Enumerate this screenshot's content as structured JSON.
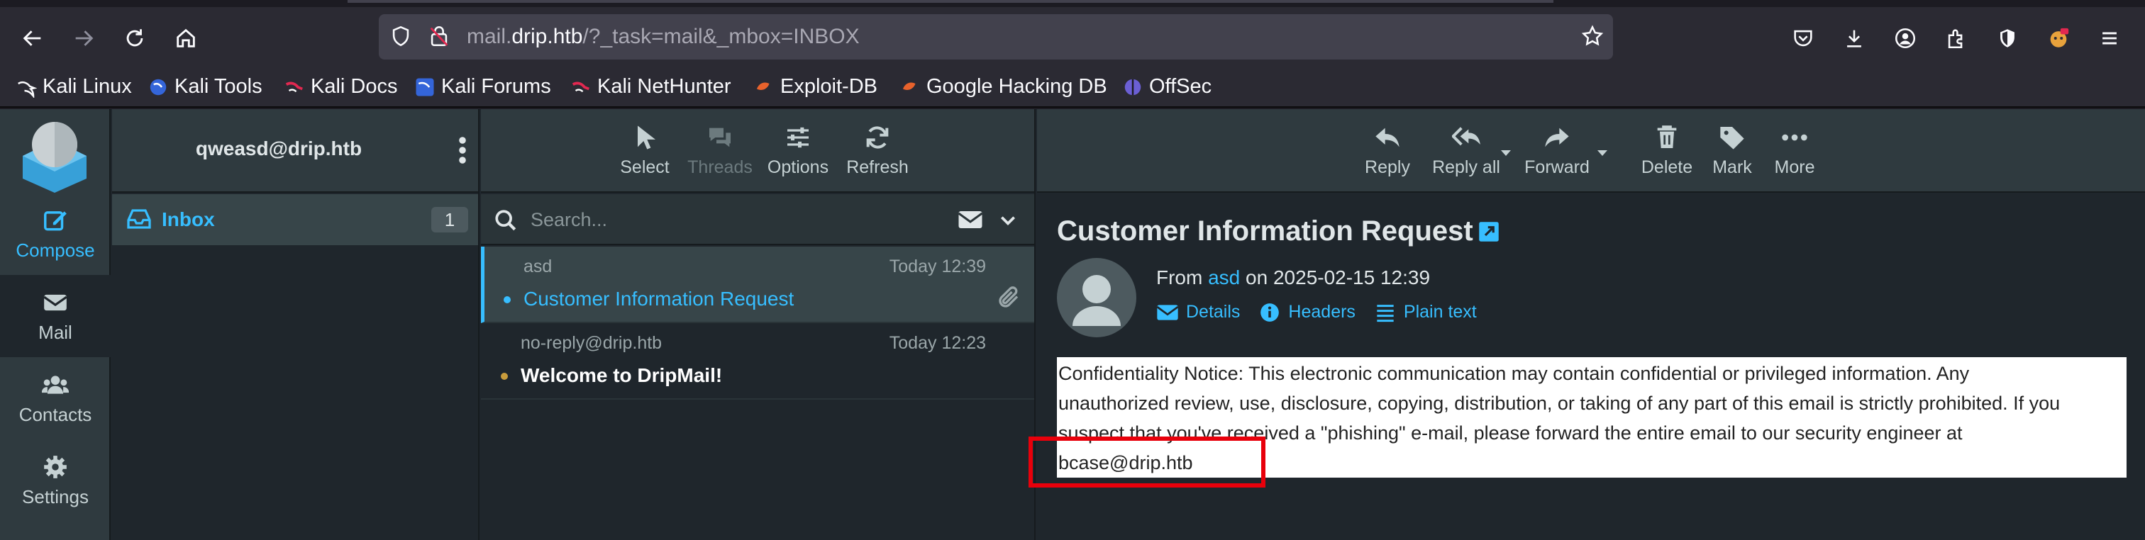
{
  "browser": {
    "url_prefix": "mail.",
    "url_host": "drip.htb",
    "url_path": "/?_task=mail&_mbox=INBOX",
    "toolbar_icons": [
      "back-icon",
      "forward-icon",
      "reload-icon",
      "home-icon",
      "shield-icon",
      "lock-icon",
      "star-icon",
      "pocket-icon",
      "download-icon",
      "account-icon",
      "extensions-icon",
      "ublock-icon",
      "profile-badge-icon",
      "hamburger-menu-icon"
    ]
  },
  "bookmarks": [
    {
      "label": "Kali Linux",
      "icon": "kali-icon"
    },
    {
      "label": "Kali Tools",
      "icon": "kali-tools-icon"
    },
    {
      "label": "Kali Docs",
      "icon": "kali-docs-icon"
    },
    {
      "label": "Kali Forums",
      "icon": "kali-forums-icon"
    },
    {
      "label": "Kali NetHunter",
      "icon": "nethunter-icon"
    },
    {
      "label": "Exploit-DB",
      "icon": "exploitdb-icon"
    },
    {
      "label": "Google Hacking DB",
      "icon": "ghdb-icon"
    },
    {
      "label": "OffSec",
      "icon": "offsec-icon"
    }
  ],
  "taskmenu": {
    "compose": "Compose",
    "mail": "Mail",
    "contacts": "Contacts",
    "settings": "Settings"
  },
  "folders": {
    "account": "qweasd@drip.htb",
    "items": [
      {
        "label": "Inbox",
        "count": "1"
      }
    ]
  },
  "list_toolbar": {
    "select": "Select",
    "threads": "Threads",
    "options": "Options",
    "refresh": "Refresh"
  },
  "search": {
    "placeholder": "Search..."
  },
  "messages": [
    {
      "from": "asd",
      "date": "Today 12:39",
      "subject": "Customer Information Request",
      "unread": false,
      "attachment": true
    },
    {
      "from": "no-reply@drip.htb",
      "date": "Today 12:23",
      "subject": "Welcome to DripMail!",
      "unread": true,
      "attachment": false
    }
  ],
  "preview_toolbar": {
    "reply": "Reply",
    "reply_all": "Reply all",
    "forward": "Forward",
    "delete": "Delete",
    "mark": "Mark",
    "more": "More"
  },
  "message": {
    "subject": "Customer Information Request",
    "from_prefix": "From",
    "sender": "asd",
    "date_text": "on 2025-02-15 12:39",
    "links": {
      "details": "Details",
      "headers": "Headers",
      "plain_text": "Plain text"
    },
    "body_line1": "Confidentiality Notice: This electronic communication may contain confidential or privileged information. Any",
    "body_line2": "unauthorized review, use, disclosure, copying, distribution, or taking of any part of this email is strictly prohibited. If you",
    "body_line3": "suspect that you've received a \"phishing\" e-mail, please forward the entire email to our security engineer at",
    "body_line4": "bcase@drip.htb"
  },
  "colors": {
    "accent": "#37beff",
    "highlight_box": "#e8000b",
    "unread_dot": "#c89c3c"
  }
}
